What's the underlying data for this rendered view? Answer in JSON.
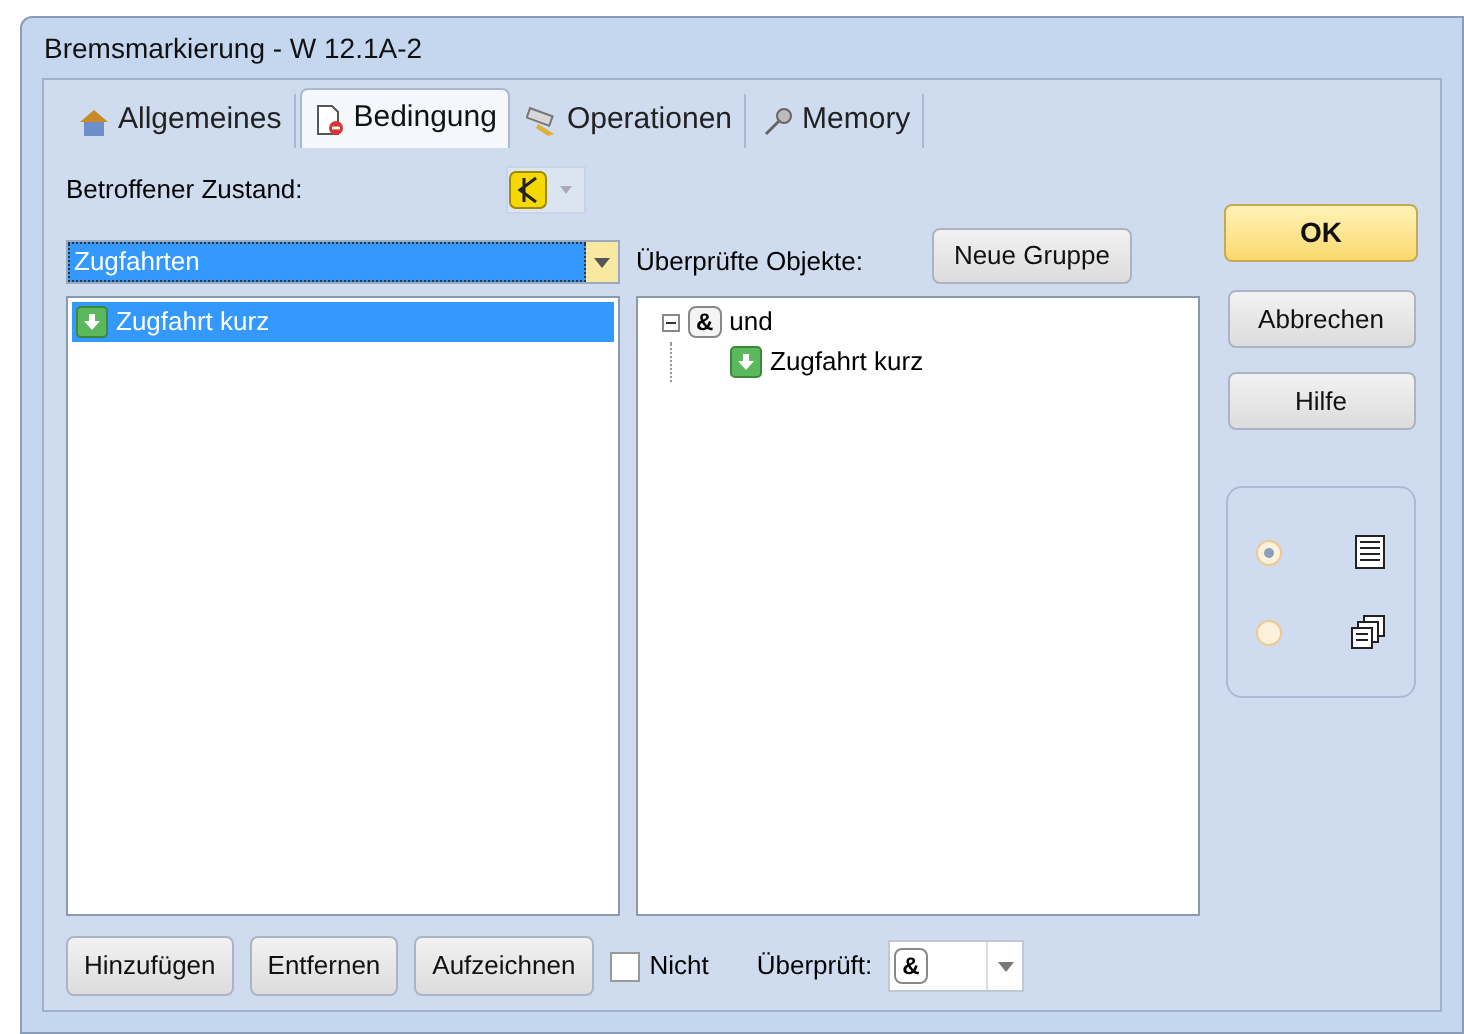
{
  "window": {
    "title": "Bremsmarkierung - W 12.1A-2"
  },
  "tabs": [
    {
      "label": "Allgemeines",
      "selected": false,
      "kind": "general"
    },
    {
      "label": "Bedingung",
      "selected": true,
      "kind": "condition"
    },
    {
      "label": "Operationen",
      "selected": false,
      "kind": "operations"
    },
    {
      "label": "Memory",
      "selected": false,
      "kind": "memory"
    }
  ],
  "state_label": "Betroffener Zustand:",
  "category_combo": {
    "value": "Zugfahrten"
  },
  "available_list": {
    "items": [
      {
        "label": "Zugfahrt kurz",
        "selected": true
      }
    ]
  },
  "checked_label": "Überprüfte Objekte:",
  "new_group_button": "Neue Gruppe",
  "tree": [
    {
      "label": "und",
      "kind": "and",
      "symbol": "&",
      "expanded": true,
      "children": [
        {
          "label": "Zugfahrt kurz",
          "kind": "train"
        }
      ]
    }
  ],
  "bottom_buttons": [
    "Hinzufügen",
    "Entfernen",
    "Aufzeichnen"
  ],
  "not_checkbox": {
    "label": "Nicht",
    "checked": false
  },
  "checked_by": {
    "label": "Überprüft:",
    "value": "&"
  },
  "dialog_buttons": [
    {
      "label": "OK",
      "kind": "default"
    },
    {
      "label": "Abbrechen",
      "kind": "normal"
    },
    {
      "label": "Hilfe",
      "kind": "normal"
    }
  ],
  "view_options": [
    {
      "kind": "list",
      "selected": true
    },
    {
      "kind": "cascade",
      "selected": false
    }
  ]
}
